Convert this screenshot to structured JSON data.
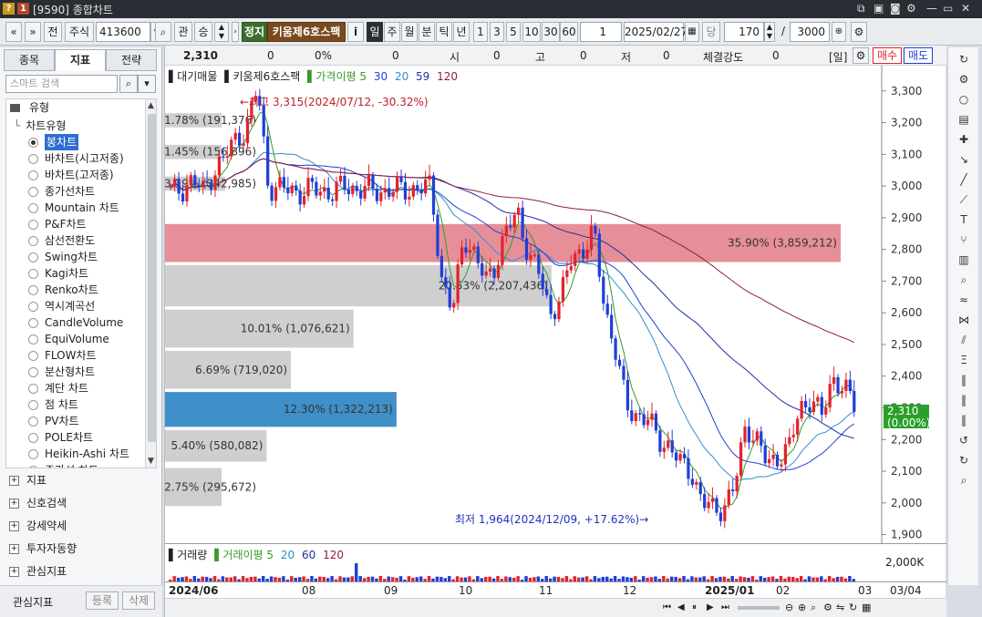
{
  "window": {
    "title": "[9590] 종합차트",
    "badge_q": "?",
    "badge_one": "1"
  },
  "toolbar": {
    "code": "413600",
    "market": "주식",
    "prev": "전",
    "button_kwan": "관",
    "button_seung": "승",
    "stop_label": "정지",
    "stock_name": "키움제6호스팩",
    "info_icon": "i",
    "periods": [
      "일",
      "주",
      "월",
      "분",
      "틱",
      "년"
    ],
    "active_period": "일",
    "intervals": [
      "1",
      "3",
      "5",
      "10",
      "30",
      "60"
    ],
    "interval_value": "1",
    "date": "2025/02/27",
    "dang": "당",
    "count": "170",
    "slash": "/",
    "total": "3000"
  },
  "left_panel": {
    "tabs": [
      "종목",
      "지표",
      "전략"
    ],
    "active_tab": "지표",
    "search_placeholder": "스마트 검색",
    "group_label": "유형",
    "subgroup_label": "차트유형",
    "chart_types": [
      "봉차트",
      "바차트(시고저종)",
      "바차트(고저종)",
      "종가선차트",
      "Mountain 차트",
      "P&F차트",
      "삼선전환도",
      "Swing차트",
      "Kagi차트",
      "Renko차트",
      "역시계곡선",
      "CandleVolume",
      "EquiVolume",
      "FLOW차트",
      "분산형차트",
      "계단 차트",
      "점 차트",
      "PV차트",
      "POLE차트",
      "Heikin-Ashi 차트",
      "주가선 차트"
    ],
    "selected_type": "봉차트",
    "sections": [
      "지표",
      "신호검색",
      "강세약세",
      "투자자동향",
      "관심지표"
    ],
    "bottom_label": "관심지표",
    "register": "등록",
    "delete": "삭제"
  },
  "infobar": {
    "price": "2,310",
    "change": "0",
    "rate": "0%",
    "volume": "0",
    "open_label": "시",
    "open": "0",
    "high_label": "고",
    "high": "0",
    "low_label": "저",
    "low": "0",
    "strength_label": "체결강도",
    "strength": "0",
    "period_tag": "[일]",
    "buy": "매수",
    "sell": "매도"
  },
  "legend": {
    "prefix": "▌대기매물",
    "name": "▌키움제6호스팩",
    "ma_label": "▌가격이평 5",
    "ma30": "30",
    "ma20": "20",
    "ma59": "59",
    "ma120": "120",
    "vol_prefix": "▌거래량",
    "vol_ma": "▌거래이평 5",
    "vol_20": "20",
    "vol_60": "60",
    "vol_120": "120",
    "vol_axis": "2,000K"
  },
  "annotations": {
    "high": "←최고 3,315(2024/07/12, -30.32%)",
    "low": "최저 1,964(2024/12/09, +17.62%)→",
    "current_price": "2,310",
    "current_rate": "(0.00%)"
  },
  "colors": {
    "up": "#e0242c",
    "down": "#1f3fd6",
    "ma5": "#3a9a2a",
    "ma20": "#2f8fd0",
    "ma30": "#1f3fd6",
    "ma60": "#2030a0",
    "ma120": "#8a2040",
    "vp_highlight": "#e68f98",
    "vp_current": "#3f8fc8"
  },
  "chart_data": {
    "type": "candlestick",
    "ylim": [
      1870,
      3380
    ],
    "y_ticks": [
      "3,300",
      "3,200",
      "3,100",
      "3,000",
      "2,900",
      "2,800",
      "2,700",
      "2,600",
      "2,500",
      "2,400",
      "2,300",
      "2,200",
      "2,100",
      "2,000",
      "1,900"
    ],
    "x_labels": [
      "2024/06",
      "08",
      "09",
      "10",
      "11",
      "12",
      "2025/01",
      "02",
      "03",
      "03/04"
    ],
    "volume_profile": [
      {
        "pct": "1.78%",
        "vol": "191,376",
        "value": 191376
      },
      {
        "pct": "1.45%",
        "vol": "156,896",
        "value": 156896
      },
      {
        "pct": "3.19%",
        "vol": "342,985",
        "value": 342985
      },
      {
        "pct": "35.90%",
        "vol": "3,859,212",
        "value": 3859212
      },
      {
        "pct": "20.53%",
        "vol": "2,207,436",
        "value": 2207436
      },
      {
        "pct": "10.01%",
        "vol": "1,076,621",
        "value": 1076621
      },
      {
        "pct": "6.69%",
        "vol": "719,020",
        "value": 719020
      },
      {
        "pct": "12.30%",
        "vol": "1,322,213",
        "value": 1322213
      },
      {
        "pct": "5.40%",
        "vol": "580,082",
        "value": 580082
      },
      {
        "pct": "2.75%",
        "vol": "295,672",
        "value": 295672
      }
    ],
    "close_path_points": [
      [
        2980,
        2990
      ],
      [
        3020,
        2980
      ],
      [
        3050,
        3090
      ],
      [
        3150,
        3180
      ],
      [
        3315,
        3000
      ],
      [
        2990,
        2990
      ],
      [
        2980,
        2990
      ],
      [
        2985,
        2980
      ],
      [
        3000,
        2990
      ],
      [
        2990,
        2985
      ],
      [
        2985,
        2990
      ],
      [
        2990,
        2990
      ],
      [
        3000,
        2700
      ],
      [
        2600,
        2850
      ],
      [
        2780,
        2700
      ],
      [
        2760,
        2860
      ],
      [
        2920,
        2780
      ],
      [
        2720,
        2600
      ],
      [
        2650,
        2780
      ],
      [
        2800,
        2850
      ],
      [
        2620,
        2480
      ],
      [
        2300,
        2280
      ],
      [
        2260,
        2200
      ],
      [
        2180,
        2120
      ],
      [
        2100,
        2000
      ],
      [
        1980,
        1990
      ],
      [
        2050,
        2250
      ],
      [
        2200,
        2120
      ],
      [
        2150,
        2170
      ],
      [
        2300,
        2330
      ],
      [
        2270,
        2400
      ],
      [
        2360,
        2310
      ]
    ],
    "volume_peak": "2024/09"
  }
}
